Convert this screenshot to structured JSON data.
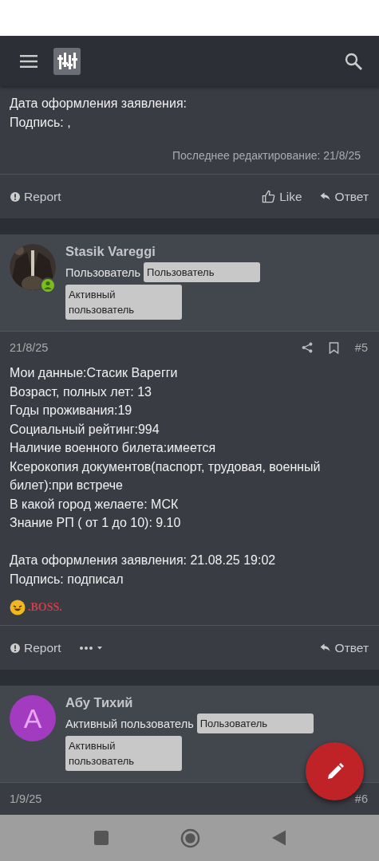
{
  "posts": [
    {
      "kind": "tail",
      "lines": [
        "Дата оформления заявления:",
        "Подпись: ,"
      ],
      "edited": "Последнее редактирование: 21/8/25",
      "actions": [
        {
          "kind": "report",
          "label": "Report"
        },
        {
          "kind": "like",
          "label": "Like"
        },
        {
          "kind": "reply",
          "label": "Ответ"
        }
      ]
    },
    {
      "kind": "full",
      "author": {
        "name": "Stasik Vareggi",
        "avatar": {
          "kind": "picture"
        },
        "online": true,
        "title": "Пользователь",
        "banners": [
          "Пользователь",
          "Активный пользователь"
        ]
      },
      "date": "21/8/25",
      "number": "#5",
      "tools": [
        {
          "kind": "share"
        },
        {
          "kind": "bookmark"
        }
      ],
      "lines": [
        "Мои данные:Стасик Варегги",
        "Возраст, полных лет: 13",
        "Годы проживания:19",
        "Социальный рейтинг:994",
        "Наличие военного билета:имеется",
        "Ксерокопия документов(паспорт, трудовая, военный билет):при встрече",
        "В какой город желаете: МСК",
        "Знание РП ( от 1 до 10): 9.10"
      ],
      "lines_2": [
        "Дата оформления заявления: 21.08.25 19:02",
        "Подпись: подписал"
      ],
      "signature": ".BOSS.",
      "actions": [
        {
          "kind": "report",
          "label": "Report"
        },
        {
          "kind": "more"
        },
        {
          "kind": "reply",
          "label": "Ответ"
        }
      ]
    },
    {
      "kind": "head",
      "author": {
        "name": "Абу Тихий",
        "avatar": {
          "kind": "letter",
          "letter": "А"
        },
        "online": false,
        "title": "Активный пользователь",
        "banners": [
          "Пользователь",
          "Активный пользователь"
        ]
      },
      "date": "1/9/25",
      "number": "#6"
    }
  ]
}
